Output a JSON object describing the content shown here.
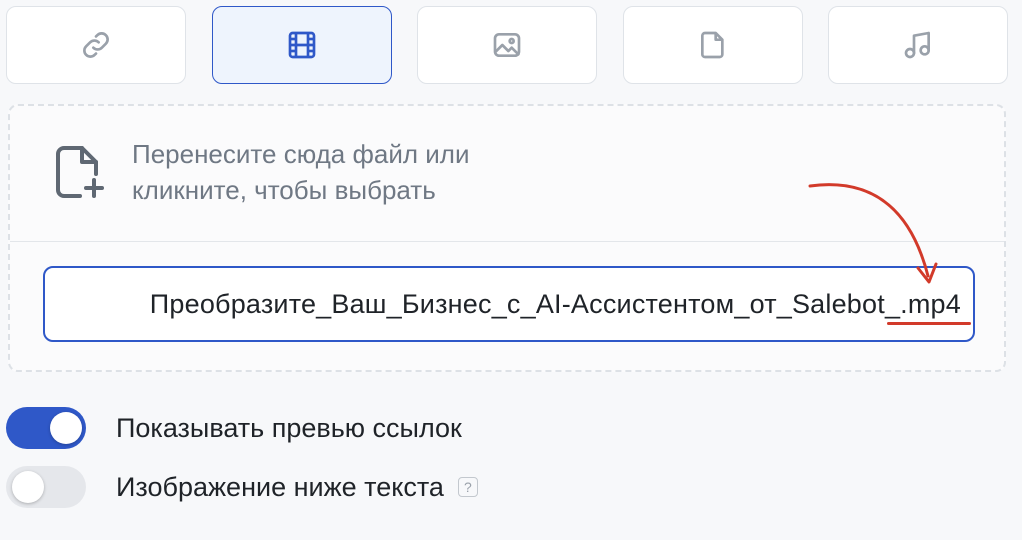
{
  "tabs": [
    {
      "name": "link",
      "icon": "link-icon",
      "active": false
    },
    {
      "name": "video",
      "icon": "film-icon",
      "active": true
    },
    {
      "name": "image",
      "icon": "image-icon",
      "active": false
    },
    {
      "name": "file",
      "icon": "document-icon",
      "active": false
    },
    {
      "name": "audio",
      "icon": "music-note-icon",
      "active": false
    }
  ],
  "dropzone": {
    "line1": "Перенесите сюда файл или",
    "line2": "кликните, чтобы выбрать",
    "icon": "file-plus-icon"
  },
  "file_input": {
    "value": "Преобразите_Ваш_Бизнес_с_AI-Ассистентом_от_Salebot_.mp4"
  },
  "toggles": {
    "link_preview": {
      "label": "Показывать превью ссылок",
      "on": true
    },
    "image_below": {
      "label": "Изображение ниже текста",
      "on": false,
      "help": "?"
    }
  },
  "colors": {
    "accent": "#2f58c8",
    "annotation": "#d23a2a",
    "icon_gray": "#9aa1aa"
  }
}
